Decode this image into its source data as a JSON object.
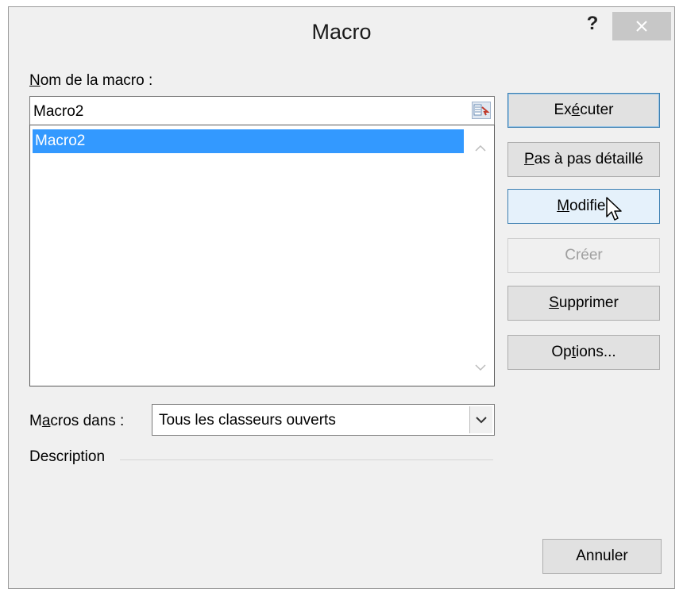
{
  "dialog": {
    "title": "Macro",
    "help_label": "?"
  },
  "name_label": {
    "first": "N",
    "rest": "om de la macro :"
  },
  "name_input": {
    "value": "Macro2"
  },
  "macro_list": {
    "items": [
      {
        "label": "Macro2",
        "selected": true
      }
    ]
  },
  "buttons": {
    "run": {
      "pre": "Ex",
      "key": "é",
      "post": "cuter"
    },
    "step": {
      "pre": "",
      "key": "P",
      "post": "as à pas détaillé"
    },
    "edit": {
      "pre": "",
      "key": "M",
      "post": "odifier"
    },
    "create": {
      "pre": "",
      "key": "C",
      "post": "réer"
    },
    "delete": {
      "pre": "",
      "key": "S",
      "post": "upprimer"
    },
    "options": {
      "pre": "Op",
      "key": "t",
      "post": "ions..."
    },
    "cancel": {
      "label": "Annuler"
    }
  },
  "macros_in": {
    "label_pre": "M",
    "label_key": "a",
    "label_post": "cros dans :",
    "selected": "Tous les classeurs ouverts"
  },
  "description_label": "Description",
  "colors": {
    "selection": "#3399ff",
    "close_button": "#c7c7c7",
    "dialog_bg": "#f0f0f0"
  }
}
